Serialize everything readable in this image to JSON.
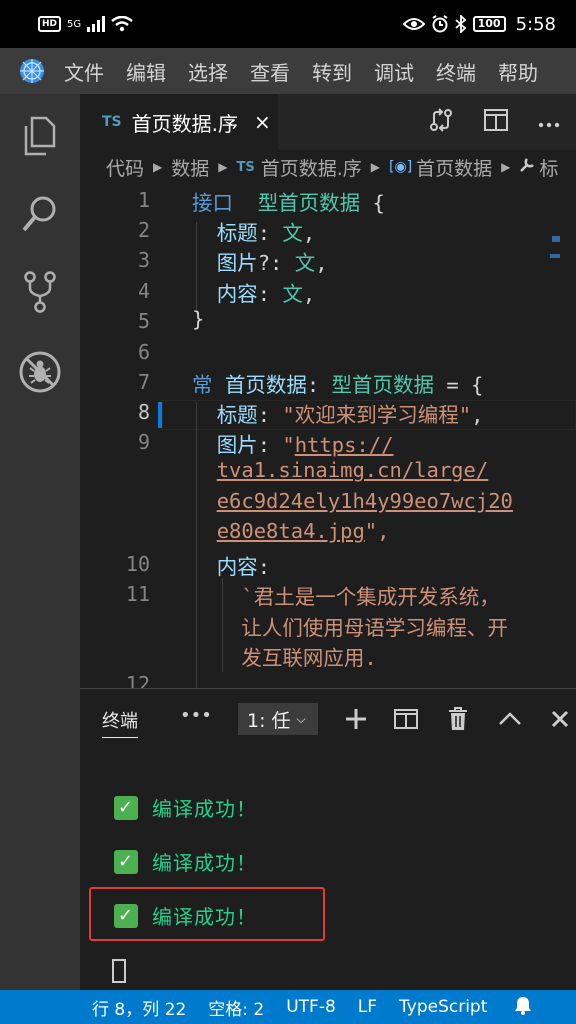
{
  "status_bar": {
    "hd": "HD",
    "signal": "5G",
    "battery": "100",
    "time": "5:58"
  },
  "menu": [
    "文件",
    "编辑",
    "选择",
    "查看",
    "转到",
    "调试",
    "终端",
    "帮助"
  ],
  "tab": {
    "badge": "TS",
    "title": "首页数据.序",
    "close": "×"
  },
  "breadcrumb": {
    "items": [
      "代码",
      "数据",
      "首页数据.序",
      "首页数据"
    ],
    "ts_badge": "TS",
    "tail": "标"
  },
  "editor": {
    "line_numbers": [
      "1",
      "2",
      "3",
      "4",
      "5",
      "6",
      "7",
      "8",
      "9",
      "10",
      "11",
      "12"
    ],
    "active_line": "8",
    "code": {
      "l1_kw": "接口",
      "l1_type": "型首页数据",
      "l1_brace": " {",
      "l2_prop": "标题",
      "l2_type": "文",
      "l3_prop": "图片",
      "l3_opt": "?",
      "l3_type": "文",
      "l4_prop": "内容",
      "l4_type": "文",
      "l5": "}",
      "l7_kw": "常",
      "l7_name": "首页数据",
      "l7_type": "型首页数据",
      "l7_eq": " = {",
      "l8_prop": "标题",
      "l8_str": "\"欢迎来到学习编程\"",
      "l9_prop": "图片",
      "l9_q": "\"",
      "l9_url1": "https://",
      "l9_url2": "tva1.sinaimg.cn/large/",
      "l9_url3": "e6c9d24ely1h4y99eo7wcj20",
      "l9_url4": "e80e8ta4.jpg",
      "l9_end": "\",",
      "l10_prop": "内容",
      "l11_str1": "`君土是一个集成开发系统，",
      "l11_str2": "让人们使用母语学习编程、开",
      "l11_str3": "发互联网应用."
    }
  },
  "terminal": {
    "title": "终端",
    "more": "•••",
    "selector": "1: 任",
    "lines": [
      "编译成功！",
      "编译成功！",
      "编译成功！"
    ]
  },
  "vs_status": {
    "position": "行 8，列 22",
    "spaces": "空格: 2",
    "encoding": "UTF-8",
    "eol": "LF",
    "language": "TypeScript"
  }
}
